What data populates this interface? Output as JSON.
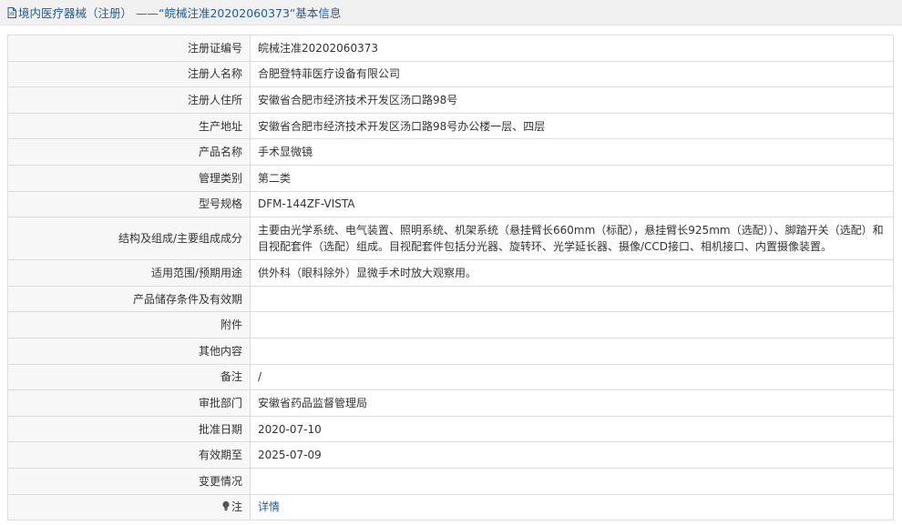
{
  "header": {
    "title": "境内医疗器械（注册） ——“皖械注准20202060373”基本信息",
    "icon": "document-icon"
  },
  "rows": [
    {
      "label": "注册证编号",
      "value": "皖械注准20202060373"
    },
    {
      "label": "注册人名称",
      "value": "合肥登特菲医疗设备有限公司"
    },
    {
      "label": "注册人住所",
      "value": "安徽省合肥市经济技术开发区汤口路98号"
    },
    {
      "label": "生产地址",
      "value": "安徽省合肥市经济技术开发区汤口路98号办公楼一层、四层"
    },
    {
      "label": "产品名称",
      "value": "手术显微镜"
    },
    {
      "label": "管理类别",
      "value": "第二类"
    },
    {
      "label": "型号规格",
      "value": "DFM-144ZF-VISTA"
    },
    {
      "label": "结构及组成/主要组成成分",
      "value": "主要由光学系统、电气装置、照明系统、机架系统（悬挂臂长660mm（标配），悬挂臂长925mm（选配））、脚踏开关（选配）和目视配套件（选配）组成。目视配套件包括分光器、旋转环、光学延长器、摄像/CCD接口、相机接口、内置摄像装置。"
    },
    {
      "label": "适用范围/预期用途",
      "value": "供外科（眼科除外）显微手术时放大观察用。"
    },
    {
      "label": "产品储存条件及有效期",
      "value": ""
    },
    {
      "label": "附件",
      "value": ""
    },
    {
      "label": "其他内容",
      "value": ""
    },
    {
      "label": "备注",
      "value": "/"
    },
    {
      "label": "审批部门",
      "value": "安徽省药品监督管理局"
    },
    {
      "label": "批准日期",
      "value": "2020-07-10"
    },
    {
      "label": "有效期至",
      "value": "2025-07-09"
    },
    {
      "label": "变更情况",
      "value": ""
    }
  ],
  "note_row": {
    "label": "注",
    "icon": "lightbulb-icon",
    "link_text": "详情"
  }
}
